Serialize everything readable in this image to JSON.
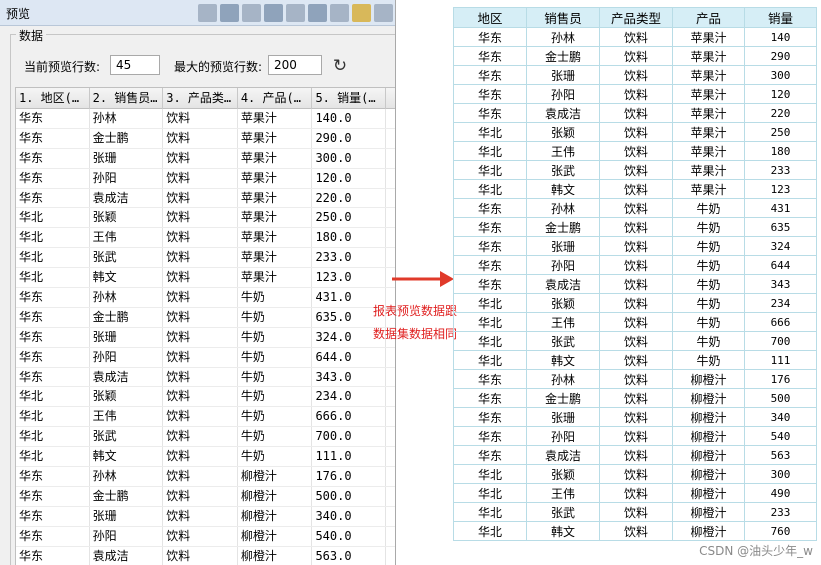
{
  "dialog": {
    "title": "预览",
    "group_label": "数据",
    "current_rows_label": "当前预览行数:",
    "current_rows_value": "45",
    "max_rows_label": "最大的预览行数:",
    "max_rows_value": "200",
    "refresh_icon": "refresh-icon"
  },
  "grid": {
    "columns": [
      "1. 地区(…",
      "2. 销售员…",
      "3. 产品类…",
      "4. 产品(…",
      "5. 销量(…"
    ],
    "rows": [
      [
        "华东",
        "孙林",
        "饮料",
        "苹果汁",
        "140.0"
      ],
      [
        "华东",
        "金士鹏",
        "饮料",
        "苹果汁",
        "290.0"
      ],
      [
        "华东",
        "张珊",
        "饮料",
        "苹果汁",
        "300.0"
      ],
      [
        "华东",
        "孙阳",
        "饮料",
        "苹果汁",
        "120.0"
      ],
      [
        "华东",
        "袁成洁",
        "饮料",
        "苹果汁",
        "220.0"
      ],
      [
        "华北",
        "张颖",
        "饮料",
        "苹果汁",
        "250.0"
      ],
      [
        "华北",
        "王伟",
        "饮料",
        "苹果汁",
        "180.0"
      ],
      [
        "华北",
        "张武",
        "饮料",
        "苹果汁",
        "233.0"
      ],
      [
        "华北",
        "韩文",
        "饮料",
        "苹果汁",
        "123.0"
      ],
      [
        "华东",
        "孙林",
        "饮料",
        "牛奶",
        "431.0"
      ],
      [
        "华东",
        "金士鹏",
        "饮料",
        "牛奶",
        "635.0"
      ],
      [
        "华东",
        "张珊",
        "饮料",
        "牛奶",
        "324.0"
      ],
      [
        "华东",
        "孙阳",
        "饮料",
        "牛奶",
        "644.0"
      ],
      [
        "华东",
        "袁成洁",
        "饮料",
        "牛奶",
        "343.0"
      ],
      [
        "华北",
        "张颖",
        "饮料",
        "牛奶",
        "234.0"
      ],
      [
        "华北",
        "王伟",
        "饮料",
        "牛奶",
        "666.0"
      ],
      [
        "华北",
        "张武",
        "饮料",
        "牛奶",
        "700.0"
      ],
      [
        "华北",
        "韩文",
        "饮料",
        "牛奶",
        "111.0"
      ],
      [
        "华东",
        "孙林",
        "饮料",
        "柳橙汁",
        "176.0"
      ],
      [
        "华东",
        "金士鹏",
        "饮料",
        "柳橙汁",
        "500.0"
      ],
      [
        "华东",
        "张珊",
        "饮料",
        "柳橙汁",
        "340.0"
      ],
      [
        "华东",
        "孙阳",
        "饮料",
        "柳橙汁",
        "540.0"
      ],
      [
        "华东",
        "袁成洁",
        "饮料",
        "柳橙汁",
        "563.0"
      ]
    ]
  },
  "annotation": {
    "text_line1": "报表预览数据跟",
    "text_line2": "数据集数据相同",
    "color": "#e02020"
  },
  "report": {
    "headers": [
      "地区",
      "销售员",
      "产品类型",
      "产品",
      "销量"
    ],
    "rows": [
      [
        "华东",
        "孙林",
        "饮料",
        "苹果汁",
        "140"
      ],
      [
        "华东",
        "金士鹏",
        "饮料",
        "苹果汁",
        "290"
      ],
      [
        "华东",
        "张珊",
        "饮料",
        "苹果汁",
        "300"
      ],
      [
        "华东",
        "孙阳",
        "饮料",
        "苹果汁",
        "120"
      ],
      [
        "华东",
        "袁成洁",
        "饮料",
        "苹果汁",
        "220"
      ],
      [
        "华北",
        "张颖",
        "饮料",
        "苹果汁",
        "250"
      ],
      [
        "华北",
        "王伟",
        "饮料",
        "苹果汁",
        "180"
      ],
      [
        "华北",
        "张武",
        "饮料",
        "苹果汁",
        "233"
      ],
      [
        "华北",
        "韩文",
        "饮料",
        "苹果汁",
        "123"
      ],
      [
        "华东",
        "孙林",
        "饮料",
        "牛奶",
        "431"
      ],
      [
        "华东",
        "金士鹏",
        "饮料",
        "牛奶",
        "635"
      ],
      [
        "华东",
        "张珊",
        "饮料",
        "牛奶",
        "324"
      ],
      [
        "华东",
        "孙阳",
        "饮料",
        "牛奶",
        "644"
      ],
      [
        "华东",
        "袁成洁",
        "饮料",
        "牛奶",
        "343"
      ],
      [
        "华北",
        "张颖",
        "饮料",
        "牛奶",
        "234"
      ],
      [
        "华北",
        "王伟",
        "饮料",
        "牛奶",
        "666"
      ],
      [
        "华北",
        "张武",
        "饮料",
        "牛奶",
        "700"
      ],
      [
        "华北",
        "韩文",
        "饮料",
        "牛奶",
        "111"
      ],
      [
        "华东",
        "孙林",
        "饮料",
        "柳橙汁",
        "176"
      ],
      [
        "华东",
        "金士鹏",
        "饮料",
        "柳橙汁",
        "500"
      ],
      [
        "华东",
        "张珊",
        "饮料",
        "柳橙汁",
        "340"
      ],
      [
        "华东",
        "孙阳",
        "饮料",
        "柳橙汁",
        "540"
      ],
      [
        "华东",
        "袁成洁",
        "饮料",
        "柳橙汁",
        "563"
      ],
      [
        "华北",
        "张颖",
        "饮料",
        "柳橙汁",
        "300"
      ],
      [
        "华北",
        "王伟",
        "饮料",
        "柳橙汁",
        "490"
      ],
      [
        "华北",
        "张武",
        "饮料",
        "柳橙汁",
        "233"
      ],
      [
        "华北",
        "韩文",
        "饮料",
        "柳橙汁",
        "760"
      ]
    ]
  },
  "footer_watermark": "CSDN @油头少年_w"
}
